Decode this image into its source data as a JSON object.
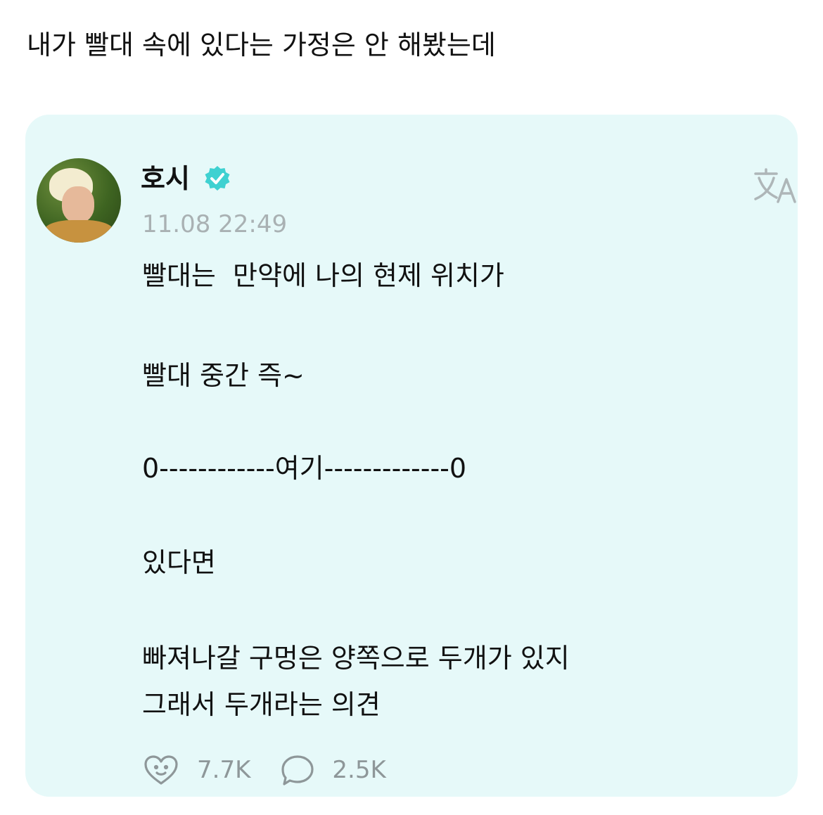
{
  "caption": "내가 빨대 속에 있다는 가정은 안 해봤는데",
  "post": {
    "author": "호시",
    "timestamp": "11.08 22:49",
    "lines": [
      "빨대는  만약에 나의 현제 위치가",
      "빨대 중간 즉~",
      "0------------여기-------------0",
      "있다면",
      "빠져나갈 구멍은 양쪽으로 두개가 있지",
      "그래서 두개라는 의견"
    ],
    "stats": {
      "likes": "7.7K",
      "comments": "2.5K"
    },
    "icons": {
      "avatar": "avatar",
      "verified": "verified-badge-icon",
      "translate": "translate-icon",
      "like": "heart-face-icon",
      "comment": "speech-bubble-icon"
    }
  },
  "colors": {
    "card_background": "#e6f9f9",
    "verified_badge": "#3fd1d1",
    "muted_text": "#a9b1b3",
    "stat_text": "#8e9799"
  }
}
